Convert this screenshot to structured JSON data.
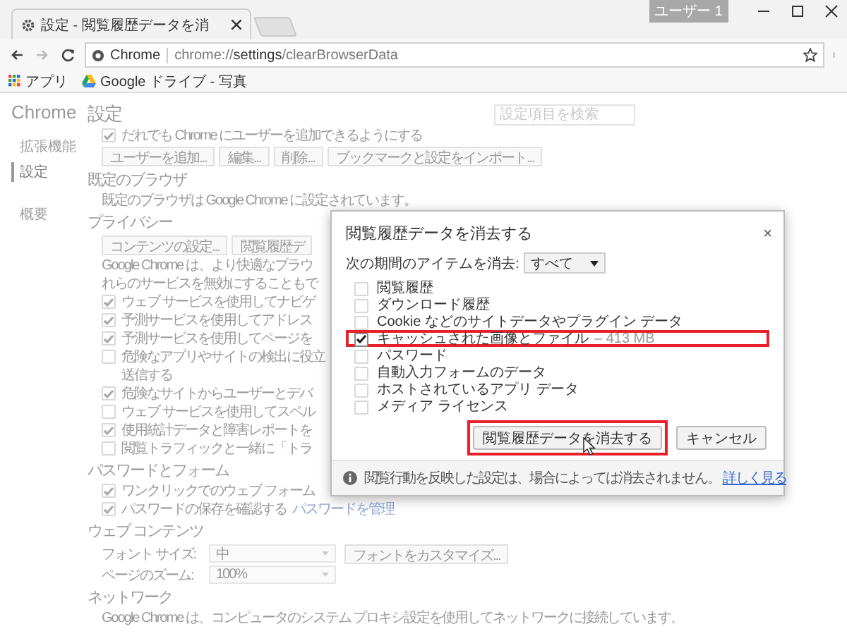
{
  "browser": {
    "tab": {
      "title": "設定 - 閲覧履歴データを消"
    },
    "profile": "ユーザー 1",
    "address": {
      "chip": "Chrome",
      "url": "chrome://**settings**/clearBrowserData"
    },
    "bookmarks": [
      {
        "kind": "apps",
        "label": "アプリ"
      },
      {
        "kind": "drive",
        "label": "Google ドライブ - 写真"
      }
    ]
  },
  "settings": {
    "brand": "Chrome",
    "title": "設定",
    "search": {
      "placeholder": "設定項目を検索"
    },
    "nav": [
      {
        "label": "拡張機能",
        "selected": false
      },
      {
        "label": "設定",
        "selected": true
      },
      {
        "label": "概要",
        "selected": false
      }
    ],
    "blocks": [
      {
        "kind": "check",
        "label": "だれでも Chrome にユーザーを追加できるようにする",
        "checked": true
      },
      {
        "kind": "buttons",
        "buttons": [
          "ユーザーを追加...",
          "編集...",
          "削除...",
          "ブックマークと設定をインポート..."
        ]
      },
      {
        "kind": "heading",
        "text": "既定のブラウザ"
      },
      {
        "kind": "text",
        "text": "既定のブラウザは Google Chrome に設定されています。"
      },
      {
        "kind": "heading",
        "text": "プライバシー"
      },
      {
        "kind": "buttons",
        "buttons": [
          "コンテンツの設定...",
          "閲覧履歴デ"
        ]
      },
      {
        "kind": "text",
        "text": "Google Chrome は、より快適なブラウ"
      },
      {
        "kind": "text",
        "text": "れらのサービスを無効にすることもで"
      },
      {
        "kind": "check",
        "label": "ウェブ サービスを使用してナビゲ",
        "checked": true
      },
      {
        "kind": "check",
        "label": "予測サービスを使用してアドレス",
        "checked": true
      },
      {
        "kind": "check",
        "label": "予測サービスを使用してページを",
        "checked": true
      },
      {
        "kind": "check",
        "label": "危険なアプリやサイトの検出に役立",
        "label2": "送信する",
        "checked": false
      },
      {
        "kind": "check",
        "label": "危険なサイトからユーザーとデバ",
        "checked": true
      },
      {
        "kind": "check",
        "label": "ウェブ サービスを使用してスペル",
        "checked": false
      },
      {
        "kind": "check",
        "label": "使用統計データと障害レポートを",
        "checked": true
      },
      {
        "kind": "check",
        "label": "閲覧トラフィックと一緒に「トラ",
        "checked": false
      },
      {
        "kind": "heading",
        "text": "パスワードとフォーム"
      },
      {
        "kind": "check",
        "label": "ワンクリックでのウェブ フォーム",
        "checked": true
      },
      {
        "kind": "check",
        "label": "パスワードの保存を確認する",
        "link": "パスワードを管理",
        "checked": true
      },
      {
        "kind": "heading",
        "text": "ウェブ コンテンツ"
      },
      {
        "kind": "select",
        "label": "フォント サイズ:",
        "value": "中",
        "button": "フォントをカスタマイズ..."
      },
      {
        "kind": "select",
        "label": "ページのズーム:",
        "value": "100%"
      },
      {
        "kind": "heading",
        "text": "ネットワーク"
      },
      {
        "kind": "text",
        "text": "Google Chrome は、コンピュータのシステム プロキシ設定を使用してネットワークに接続しています。"
      }
    ]
  },
  "dialog": {
    "title": "閲覧履歴データを消去する",
    "close": "×",
    "period": {
      "label": "次の期間のアイテムを消去:",
      "value": "すべて"
    },
    "items": [
      {
        "label": "閲覧履歴",
        "checked": false,
        "highlighted": false
      },
      {
        "label": "ダウンロード履歴",
        "checked": false,
        "highlighted": false
      },
      {
        "label": "Cookie などのサイトデータやプラグイン データ",
        "checked": false,
        "highlighted": false
      },
      {
        "label": "キャッシュされた画像とファイル",
        "note": "– 413 MB",
        "checked": true,
        "highlighted": true
      },
      {
        "label": "パスワード",
        "checked": false,
        "highlighted": false
      },
      {
        "label": "自動入力フォームのデータ",
        "checked": false,
        "highlighted": false
      },
      {
        "label": "ホストされているアプリ データ",
        "checked": false,
        "highlighted": false
      },
      {
        "label": "メディア ライセンス",
        "checked": false,
        "highlighted": false
      }
    ],
    "buttons": [
      {
        "label": "閲覧履歴データを消去する",
        "highlighted": true
      },
      {
        "label": "キャンセル",
        "highlighted": false
      }
    ],
    "footer": {
      "text": "閲覧行動を反映した設定は、場合によっては消去されません。",
      "link": "詳しく見る"
    }
  }
}
